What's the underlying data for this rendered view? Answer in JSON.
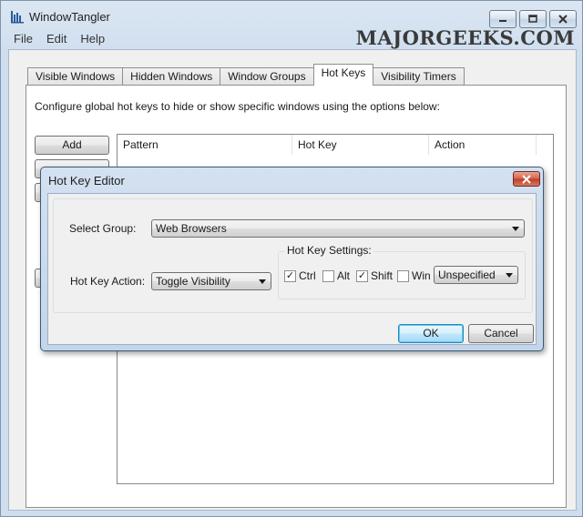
{
  "window": {
    "title": "WindowTangler",
    "watermark": "MAJORGEEKS.COM"
  },
  "menu": [
    "File",
    "Edit",
    "Help"
  ],
  "tabs": [
    {
      "label": "Visible Windows",
      "active": false
    },
    {
      "label": "Hidden Windows",
      "active": false
    },
    {
      "label": "Window Groups",
      "active": false
    },
    {
      "label": "Hot Keys",
      "active": true
    },
    {
      "label": "Visibility Timers",
      "active": false
    }
  ],
  "hotkeys_panel": {
    "description": "Configure global hot keys to hide or show specific windows using the options below:",
    "add_button": "Add",
    "columns": [
      "Pattern",
      "Hot Key",
      "Action"
    ]
  },
  "dialog": {
    "title": "Hot Key Editor",
    "select_group_label": "Select Group:",
    "select_group_value": "Web Browsers",
    "hotkey_action_label": "Hot Key Action:",
    "hotkey_action_value": "Toggle Visibility",
    "hotkey_settings_label": "Hot Key Settings:",
    "modifiers": [
      {
        "label": "Ctrl",
        "checked": true
      },
      {
        "label": "Alt",
        "checked": false
      },
      {
        "label": "Shift",
        "checked": true
      },
      {
        "label": "Win",
        "checked": false
      }
    ],
    "key_value": "Unspecified",
    "ok_label": "OK",
    "cancel_label": "Cancel"
  },
  "colors": {
    "close_red": "#c03b22",
    "default_button_blue": "#3c7fb1"
  }
}
